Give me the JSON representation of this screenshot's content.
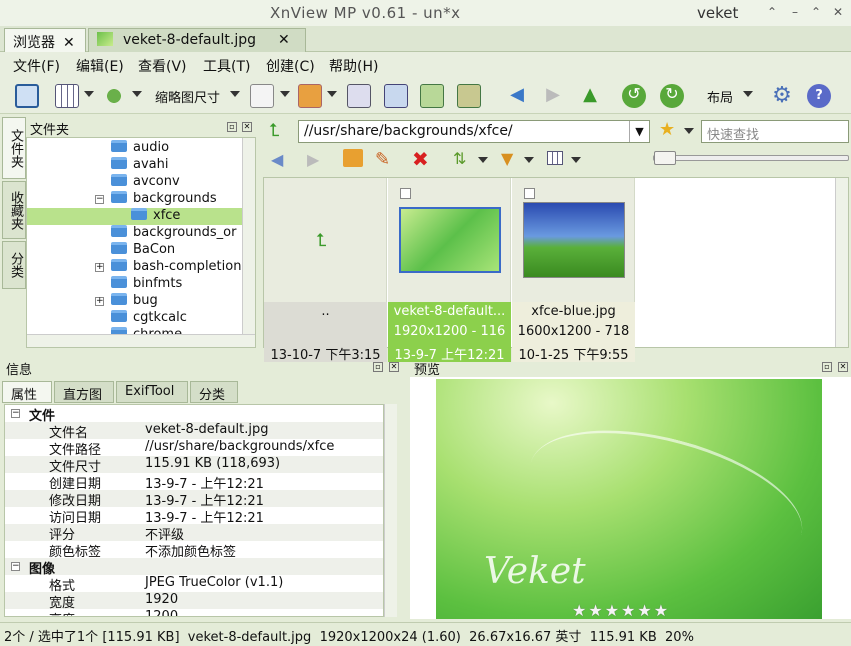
{
  "window": {
    "title": "XnView MP v0.61 - un*x",
    "user": "veket"
  },
  "tabs": [
    {
      "label": "浏览器"
    },
    {
      "label": "veket-8-default.jpg"
    }
  ],
  "menu": [
    "文件(F)",
    "编辑(E)",
    "查看(V)",
    "工具(T)",
    "创建(C)",
    "帮助(H)"
  ],
  "toolbar": {
    "thumb_size": "缩略图尺寸",
    "layout": "布局"
  },
  "side_tabs": [
    "文件夹",
    "收藏夹",
    "分类"
  ],
  "folders": {
    "title": "文件夹",
    "items": [
      "audio",
      "avahi",
      "avconv",
      "backgrounds",
      "xfce",
      "backgrounds_or",
      "BaCon",
      "bash-completion",
      "binfmts",
      "bug",
      "cgtkcalc",
      "chrome"
    ]
  },
  "address": {
    "path": "//usr/share/backgrounds/xfce/",
    "search_placeholder": "快速查找"
  },
  "thumbs": [
    {
      "name": "..",
      "res": "",
      "date": "13-10-7 下午3:15"
    },
    {
      "name": "veket-8-default...",
      "res": "1920x1200 - 116",
      "date": "13-9-7 上午12:21"
    },
    {
      "name": "xfce-blue.jpg",
      "res": "1600x1200 - 718",
      "date": "10-1-25 下午9:55"
    }
  ],
  "info": {
    "title": "信息",
    "tabs": [
      "属性",
      "直方图",
      "ExifTool",
      "分类"
    ],
    "groups": {
      "file": "文件",
      "image": "图像"
    },
    "rows": [
      {
        "k": "文件名",
        "v": "veket-8-default.jpg"
      },
      {
        "k": "文件路径",
        "v": "//usr/share/backgrounds/xfce"
      },
      {
        "k": "文件尺寸",
        "v": "115.91 KB (118,693)"
      },
      {
        "k": "创建日期",
        "v": "13-9-7 - 上午12:21"
      },
      {
        "k": "修改日期",
        "v": "13-9-7 - 上午12:21"
      },
      {
        "k": "访问日期",
        "v": "13-9-7 - 上午12:21"
      },
      {
        "k": "评分",
        "v": "不评级"
      },
      {
        "k": "颜色标签",
        "v": "不添加颜色标签"
      }
    ],
    "image_rows": [
      {
        "k": "格式",
        "v": "JPEG TrueColor (v1.1)"
      },
      {
        "k": "宽度",
        "v": "1920"
      },
      {
        "k": "高度",
        "v": "1200"
      }
    ]
  },
  "preview": {
    "title": "预览",
    "logo": "Veket",
    "rating_stars": 6
  },
  "status": {
    "selection": "2个 / 选中了1个 [115.91 KB]",
    "file": "veket-8-default.jpg",
    "dims": "1920x1200x24 (1.60)",
    "print": "26.67x16.67 英寸",
    "size": "115.91 KB",
    "zoom": "20%"
  },
  "colors": {
    "accent": "#b9e28c",
    "bg": "#e4ecd8"
  }
}
